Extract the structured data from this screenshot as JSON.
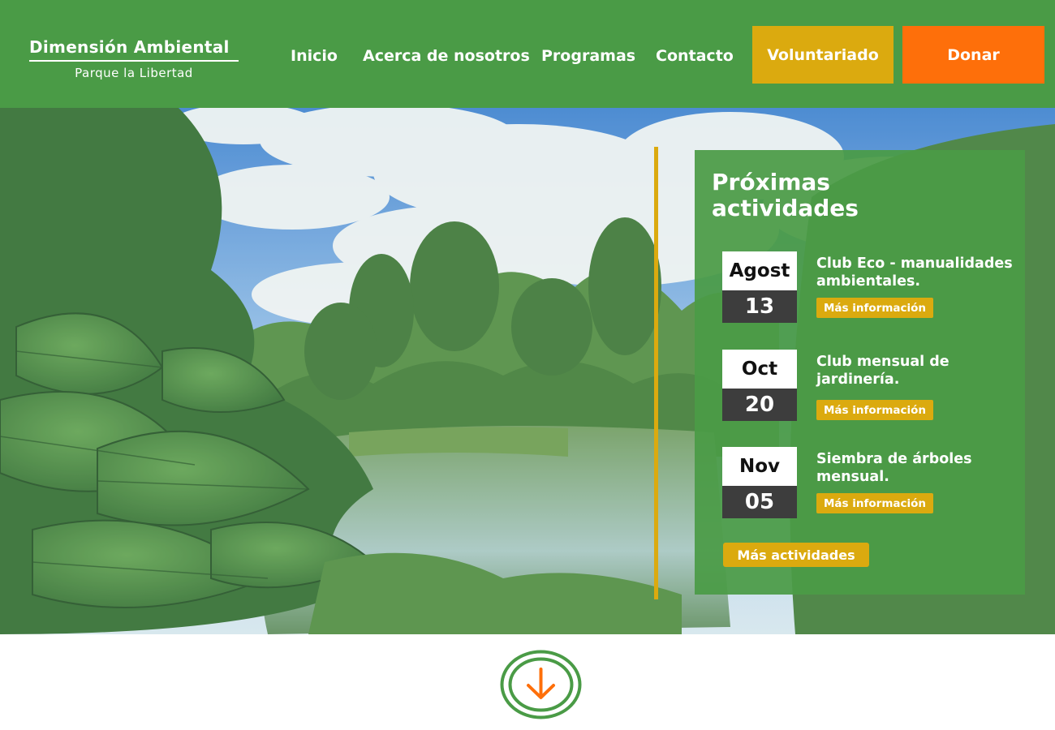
{
  "brand": {
    "title": "Dimensión Ambiental",
    "subtitle": "Parque la Libertad"
  },
  "nav": {
    "items": [
      {
        "label": "Inicio"
      },
      {
        "label": "Acerca de nosotros"
      },
      {
        "label": "Programas"
      },
      {
        "label": "Contacto"
      }
    ],
    "volunteer_label": "Voluntariado",
    "donate_label": "Donar"
  },
  "activities": {
    "title": "Próximas actividades",
    "events": [
      {
        "month": "Agost",
        "day": "13",
        "title": "Club Eco - manualidades ambientales.",
        "link_label": "Más información"
      },
      {
        "month": "Oct",
        "day": "20",
        "title": "Club mensual de jardinería.",
        "link_label": "Más información"
      },
      {
        "month": "Nov",
        "day": "05",
        "title": "Siembra de árboles\n mensual.",
        "link_label": "Más información"
      }
    ],
    "more_label": "Más actividades"
  },
  "icons": {
    "scroll": "arrow-down-circle-icon"
  },
  "colors": {
    "primary_green": "#4a9b46",
    "accent_gold": "#dbaa0f",
    "accent_orange": "#fe6f0a",
    "dark_gray": "#3d3d3d"
  }
}
